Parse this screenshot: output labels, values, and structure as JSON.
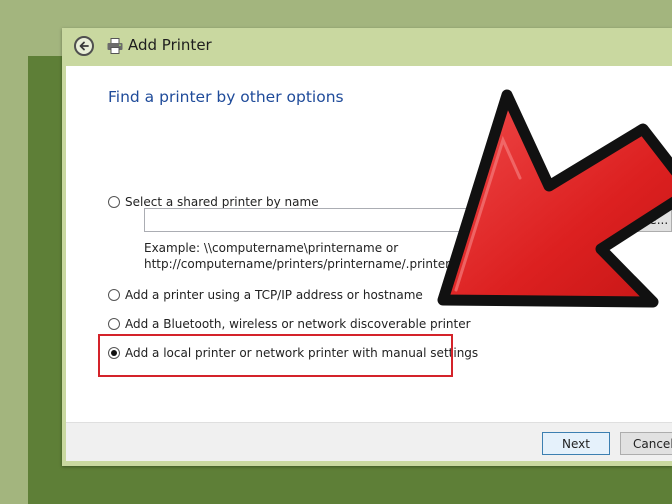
{
  "window": {
    "title": "Add Printer",
    "heading": "Find a printer by other options"
  },
  "options": [
    {
      "label": "Select a shared printer by name",
      "selected": false
    },
    {
      "label": "Add a printer using a TCP/IP address or hostname",
      "selected": false
    },
    {
      "label": "Add a Bluetooth, wireless or network discoverable printer",
      "selected": false
    },
    {
      "label": "Add a local printer or network printer with manual settings",
      "selected": true
    }
  ],
  "shared_printer": {
    "value": "",
    "browse_label": "Browse...",
    "example_line1": "Example: \\\\computername\\printername or",
    "example_line2": "http://computername/printers/printername/.printer"
  },
  "footer": {
    "next_label": "Next",
    "cancel_label": "Cancel"
  },
  "colors": {
    "heading": "#1f4b9a",
    "highlight": "#d4232a",
    "arrow": "#e02828",
    "background": "#a3b57e",
    "titlebar": "#c9d8a0"
  },
  "icons": [
    "back-arrow-icon",
    "printer-icon",
    "pointer-arrow-icon"
  ]
}
